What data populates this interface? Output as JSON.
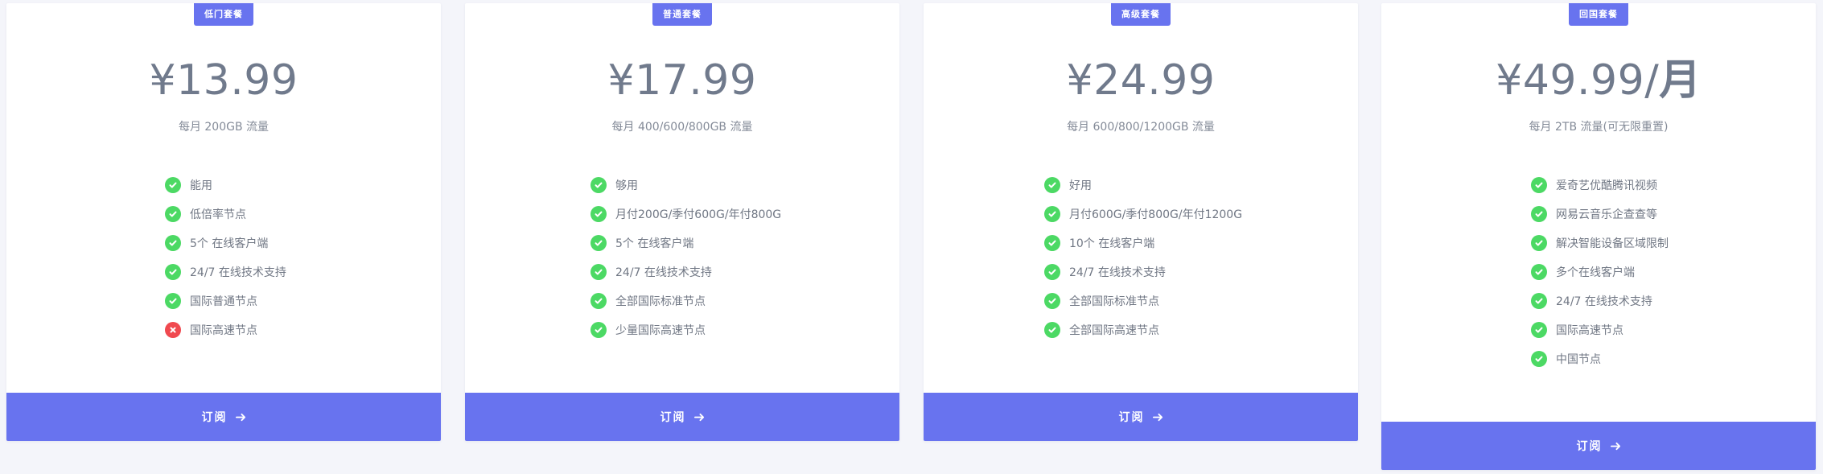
{
  "plans": [
    {
      "badge": "低门套餐",
      "price": "¥13.99",
      "price_unit": "",
      "subtitle": "每月 200GB 流量",
      "features": [
        {
          "label": "能用",
          "ok": true
        },
        {
          "label": "低倍率节点",
          "ok": true
        },
        {
          "label": "5个 在线客户端",
          "ok": true
        },
        {
          "label": "24/7 在线技术支持",
          "ok": true
        },
        {
          "label": "国际普通节点",
          "ok": true
        },
        {
          "label": "国际高速节点",
          "ok": false
        }
      ],
      "button": "订阅"
    },
    {
      "badge": "普通套餐",
      "price": "¥17.99",
      "price_unit": "",
      "subtitle": "每月 400/600/800GB 流量",
      "features": [
        {
          "label": "够用",
          "ok": true
        },
        {
          "label": "月付200G/季付600G/年付800G",
          "ok": true
        },
        {
          "label": "5个 在线客户端",
          "ok": true
        },
        {
          "label": "24/7 在线技术支持",
          "ok": true
        },
        {
          "label": "全部国际标准节点",
          "ok": true
        },
        {
          "label": "少量国际高速节点",
          "ok": true
        }
      ],
      "button": "订阅"
    },
    {
      "badge": "高级套餐",
      "price": "¥24.99",
      "price_unit": "",
      "subtitle": "每月 600/800/1200GB 流量",
      "features": [
        {
          "label": "好用",
          "ok": true
        },
        {
          "label": "月付600G/季付800G/年付1200G",
          "ok": true
        },
        {
          "label": "10个 在线客户端",
          "ok": true
        },
        {
          "label": "24/7 在线技术支持",
          "ok": true
        },
        {
          "label": "全部国际标准节点",
          "ok": true
        },
        {
          "label": "全部国际高速节点",
          "ok": true
        }
      ],
      "button": "订阅"
    },
    {
      "badge": "回国套餐",
      "price": "¥49.99/",
      "price_unit": "月",
      "subtitle": "每月 2TB 流量(可无限重置)",
      "features": [
        {
          "label": "爱奇艺优酷腾讯视频",
          "ok": true
        },
        {
          "label": "网易云音乐企查查等",
          "ok": true
        },
        {
          "label": "解决智能设备区域限制",
          "ok": true
        },
        {
          "label": "多个在线客户端",
          "ok": true
        },
        {
          "label": "24/7 在线技术支持",
          "ok": true
        },
        {
          "label": "国际高速节点",
          "ok": true
        },
        {
          "label": "中国节点",
          "ok": true
        }
      ],
      "button": "订阅"
    }
  ],
  "colors": {
    "accent": "#6873ef",
    "check": "#4cd964",
    "cross": "#f0494f",
    "background": "#f4f5fa"
  },
  "icons": {
    "ok": "check-circle-icon",
    "no": "x-circle-icon",
    "button": "arrow-right-icon"
  }
}
